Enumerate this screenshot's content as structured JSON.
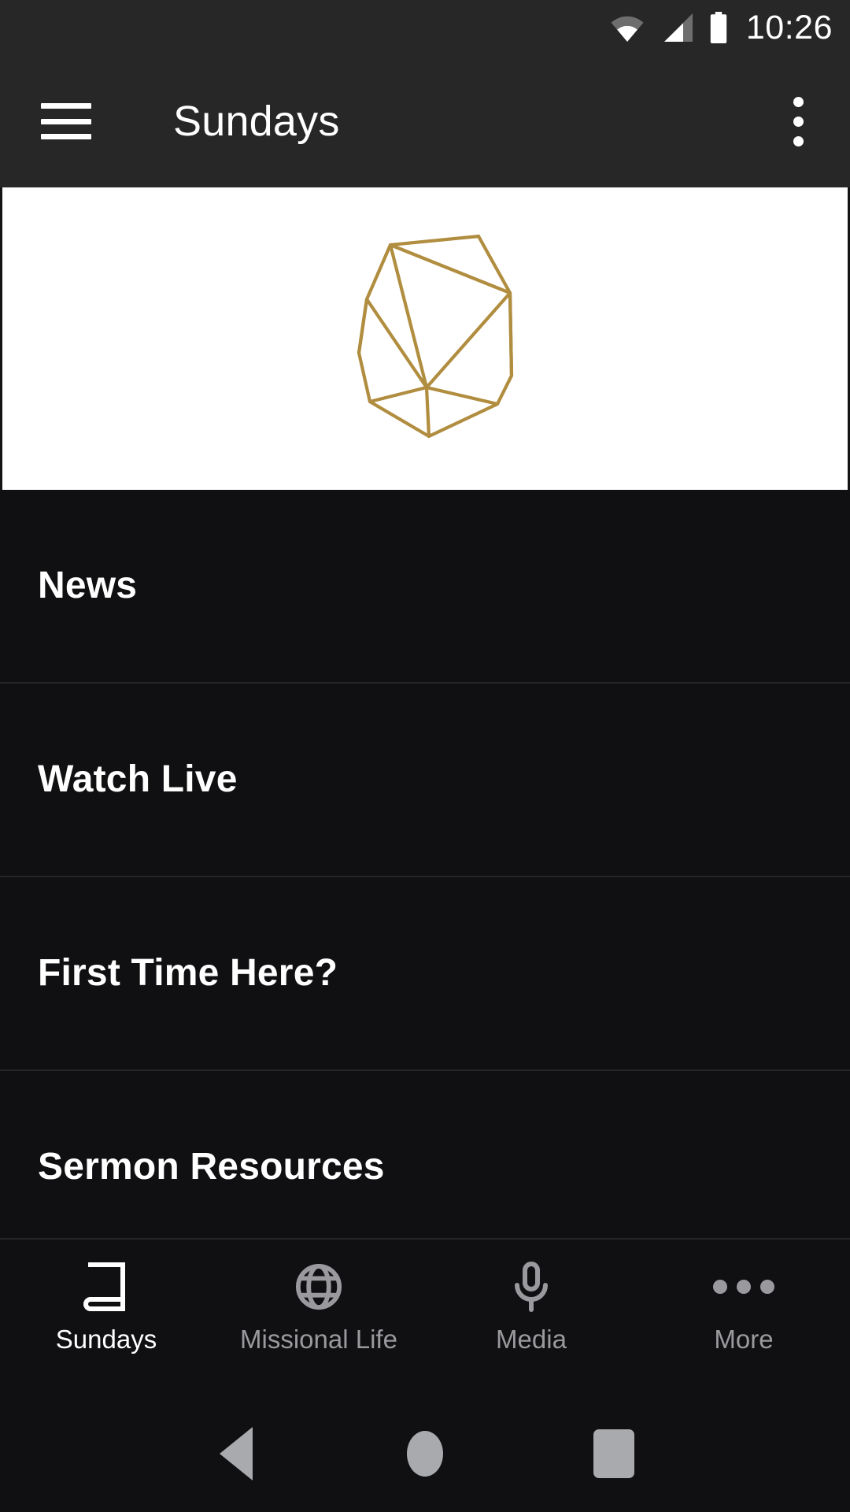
{
  "status_bar": {
    "time": "10:26",
    "icons": [
      "wifi-icon",
      "cellular-signal-icon",
      "battery-icon"
    ]
  },
  "app_bar": {
    "menu_icon": "hamburger-menu-icon",
    "title": "Sundays",
    "overflow_icon": "more-vertical-icon"
  },
  "banner": {
    "logo_name": "polygon-wireframe-logo",
    "logo_color": "#b08d3f",
    "background_color": "#ffffff"
  },
  "list": {
    "items": [
      {
        "label": "News"
      },
      {
        "label": "Watch Live"
      },
      {
        "label": "First Time Here?"
      },
      {
        "label": "Sermon Resources"
      }
    ]
  },
  "bottom_nav": {
    "active_index": 0,
    "tabs": [
      {
        "label": "Sundays",
        "icon": "book-icon"
      },
      {
        "label": "Missional Life",
        "icon": "globe-icon"
      },
      {
        "label": "Media",
        "icon": "microphone-icon"
      },
      {
        "label": "More",
        "icon": "more-horizontal-icon"
      }
    ]
  },
  "android_nav": {
    "back_label": "Back",
    "home_label": "Home",
    "recents_label": "Recents"
  },
  "colors": {
    "app_bar_bg": "#272727",
    "page_bg": "#101012",
    "divider": "#25262a",
    "accent_gold": "#b08d3f",
    "inactive_text": "#9a9a9e"
  }
}
